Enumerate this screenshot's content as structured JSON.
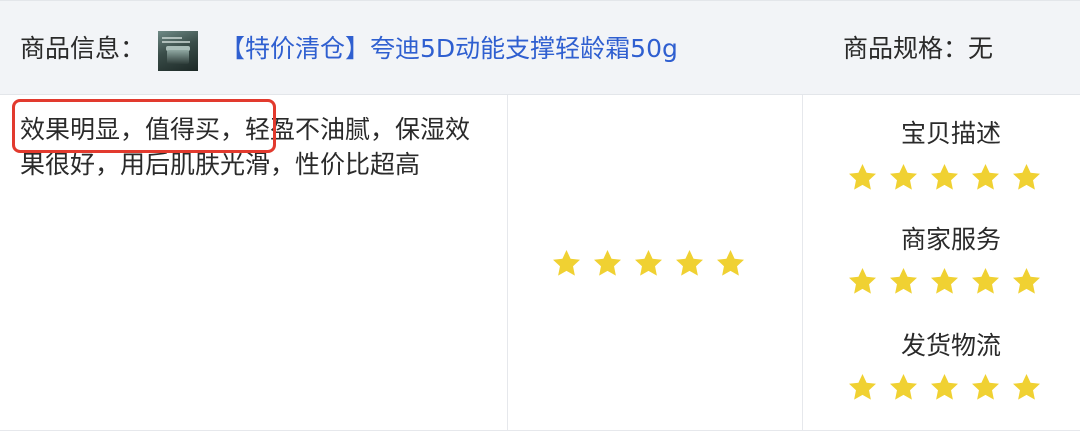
{
  "header": {
    "product_info_label": "商品信息：",
    "product_title": "【特价清仓】夸迪5D动能支撑轻龄霜50g",
    "spec_label": "商品规格：",
    "spec_value": "无"
  },
  "review": {
    "text": "效果明显，值得买，轻盈不油腻，保湿效果很好，用后肌肤光滑，性价比超高",
    "highlighted_phrase": "效果明显，值得买，"
  },
  "overall_rating": {
    "stars": 5,
    "max": 5
  },
  "shop_ratings": [
    {
      "label": "宝贝描述",
      "stars": 5,
      "max": 5
    },
    {
      "label": "商家服务",
      "stars": 5,
      "max": 5
    },
    {
      "label": "发货物流",
      "stars": 5,
      "max": 5
    }
  ],
  "colors": {
    "star": "#f0d132",
    "link": "#2f5fd0",
    "highlight_border": "#e23a2e",
    "header_bg": "#f2f4f7"
  },
  "icons": {
    "star": "star-icon",
    "thumbnail": "product-thumbnail"
  }
}
